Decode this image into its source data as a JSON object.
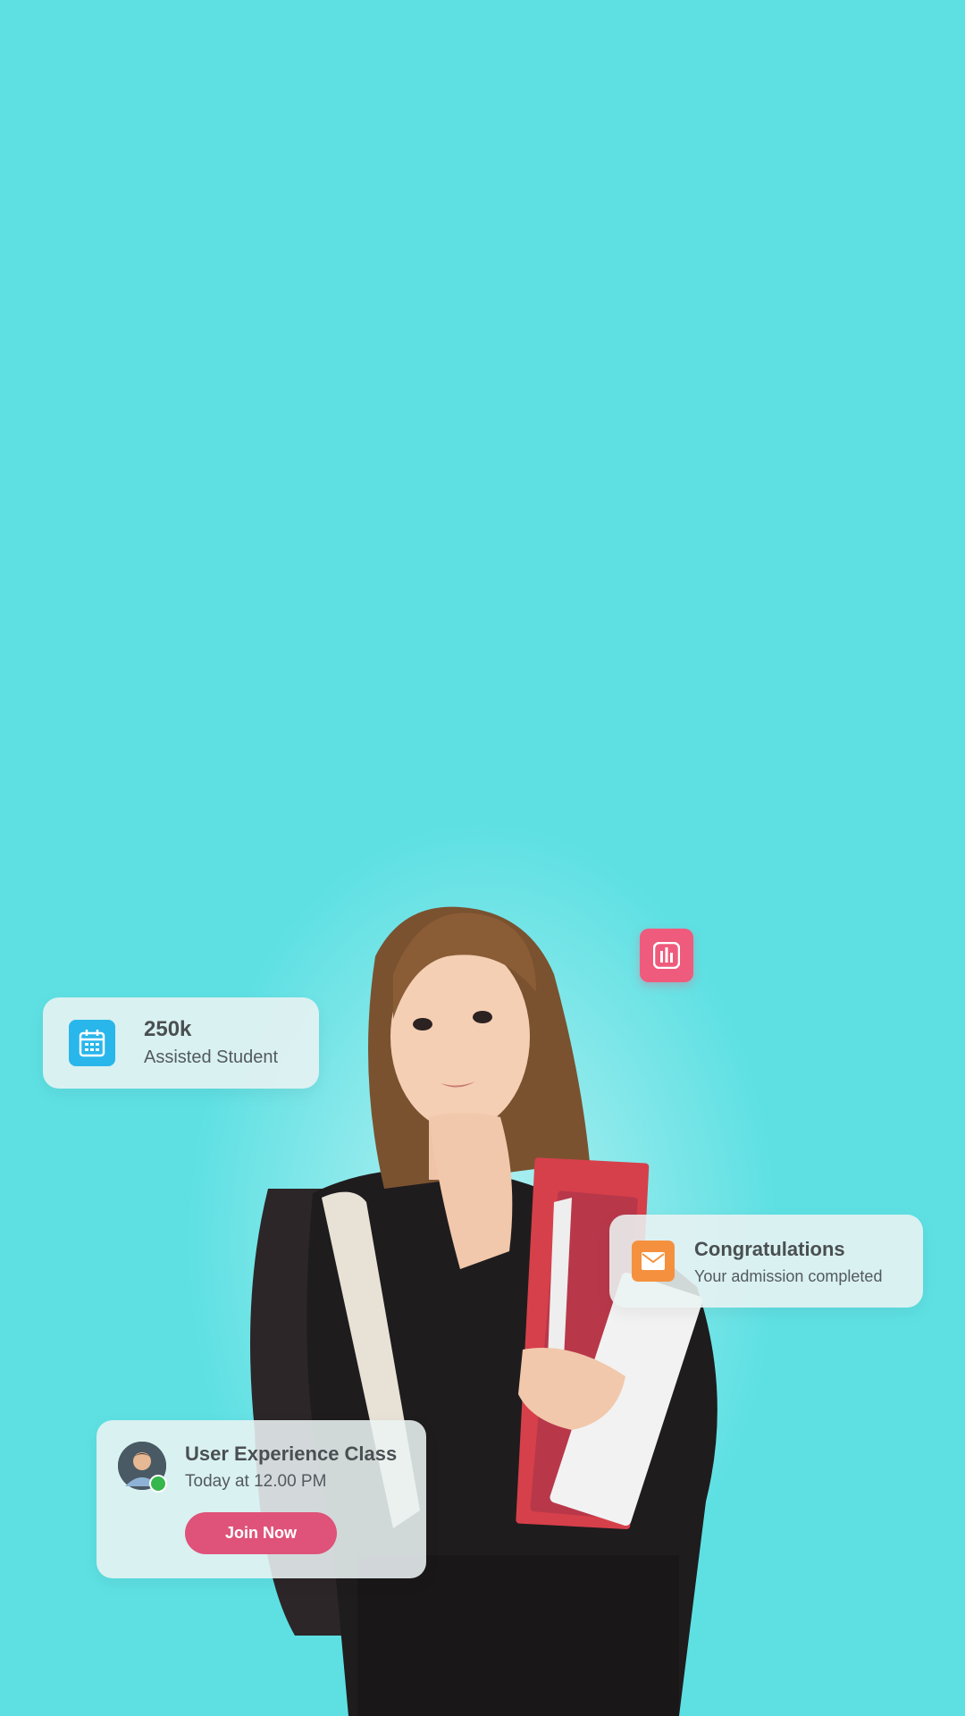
{
  "stat_card": {
    "value": "250k",
    "label": "Assisted Student",
    "icon": "calendar-icon",
    "color": "#29b6ea"
  },
  "chart_badge": {
    "icon": "bar-chart-icon",
    "color": "#ef5b7c"
  },
  "message_card": {
    "title": "Congratulations",
    "subtitle": "Your admission completed",
    "icon": "mail-icon",
    "color": "#f5913e"
  },
  "class_card": {
    "title": "User Experience Class",
    "subtitle": "Today at 12.00 PM",
    "button_label": "Join Now",
    "status": "online",
    "button_color": "#df5279"
  },
  "colors": {
    "background": "#5ee0e3"
  }
}
